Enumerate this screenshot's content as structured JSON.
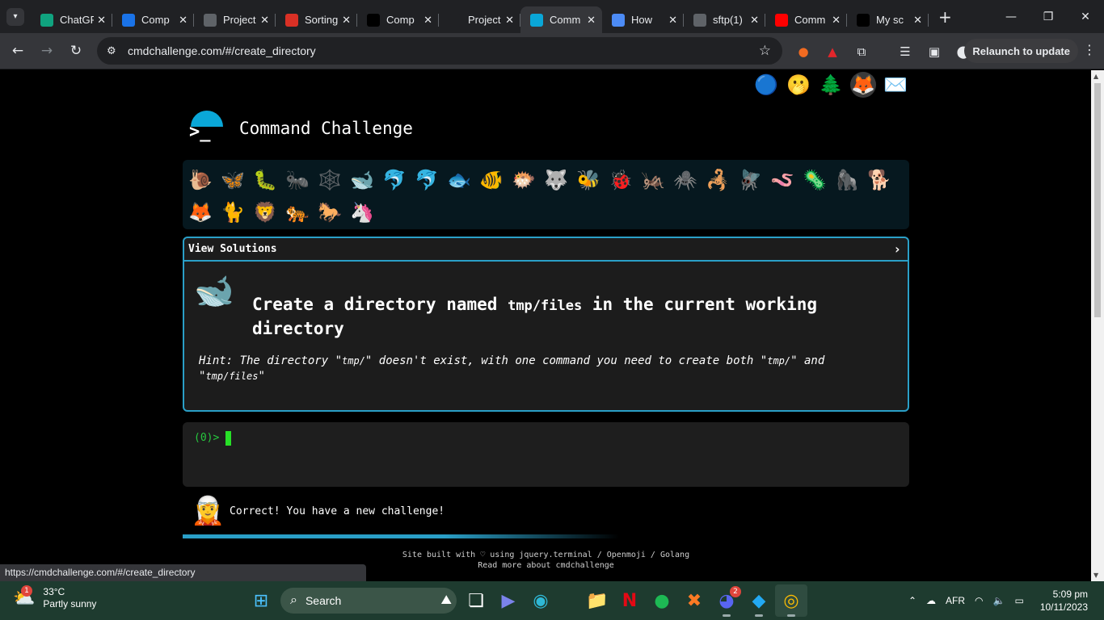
{
  "browser": {
    "tabs": [
      {
        "title": "ChatGPT",
        "fav_color": "#10a37f",
        "fav_icon": "openai-icon",
        "active": false
      },
      {
        "title": "Comp",
        "fav_color": "#1a73e8",
        "fav_icon": "drive-icon",
        "active": false
      },
      {
        "title": "Project",
        "fav_color": "#5f6368",
        "fav_icon": "loading-icon",
        "active": false
      },
      {
        "title": "Sorting",
        "fav_color": "#d93025",
        "fav_icon": "record-icon",
        "active": false
      },
      {
        "title": "Comp",
        "fav_color": "#000000",
        "fav_icon": "github-icon",
        "active": false
      },
      {
        "title": "Project",
        "fav_color": "#202124",
        "fav_icon": "page-icon",
        "active": false
      },
      {
        "title": "Comm",
        "fav_color": "#0aa7d8",
        "fav_icon": "terminal-icon",
        "active": true
      },
      {
        "title": "How",
        "fav_color": "#4c8bf5",
        "fav_icon": "globe-icon",
        "active": false
      },
      {
        "title": "sftp(1)",
        "fav_color": "#5f6368",
        "fav_icon": "settings-icon",
        "active": false
      },
      {
        "title": "Comm",
        "fav_color": "#ff0000",
        "fav_icon": "youtube-icon",
        "active": false
      },
      {
        "title": "My sc",
        "fav_color": "#000000",
        "fav_icon": "medium-icon",
        "active": false
      }
    ],
    "url": "cmdchallenge.com/#/create_directory",
    "relaunch_label": "Relaunch to update",
    "status_url": "https://cmdchallenge.com/#/create_directory"
  },
  "page": {
    "site_title": "Command Challenge",
    "top_links": [
      "🔵",
      "🫢",
      "🌲",
      "🦊",
      "✉️"
    ],
    "animals": [
      "🐌",
      "🦋",
      "🐛",
      "🐜",
      "🕸️",
      "🐋",
      "🐬",
      "🐬",
      "🐟",
      "🐠",
      "🐡",
      "🐺",
      "🐝",
      "🐞",
      "🦗",
      "🕷️",
      "🦂",
      "🪰",
      "🪱",
      "🦠",
      "🦍",
      "🐕",
      "🦊",
      "🐈",
      "🦁",
      "🐅",
      "🐎",
      "🦄"
    ],
    "view_solutions_label": "View Solutions",
    "challenge_icon": "🐋",
    "task_prefix": "Create a directory named ",
    "task_code": "tmp/files",
    "task_suffix": " in the current working directory",
    "hint_prefix": "Hint: The directory \"",
    "hint_code1": "tmp/",
    "hint_mid": "\" doesn't exist, with one command you need to create both \"",
    "hint_code2": "tmp/",
    "hint_and": "\" and \"",
    "hint_code3": "tmp/files",
    "hint_end": "\"",
    "terminal_prompt": "(0)>",
    "status_message": "Correct! You have a new challenge!",
    "footer_line1": "Site built with ♡ using jquery.terminal / Openmoji / Golang",
    "footer_line2": "Read more about cmdchallenge"
  },
  "taskbar": {
    "temp": "33°C",
    "weather": "Partly sunny",
    "weather_badge": "1",
    "search_label": "Search",
    "discord_badge": "2",
    "lang": "AFR",
    "time": "5:09 pm",
    "date": "10/11/2023"
  },
  "colors": {
    "accent": "#2a9fc7",
    "terminal_green": "#27c93f",
    "taskbar_bg": "#1e3b2f"
  }
}
